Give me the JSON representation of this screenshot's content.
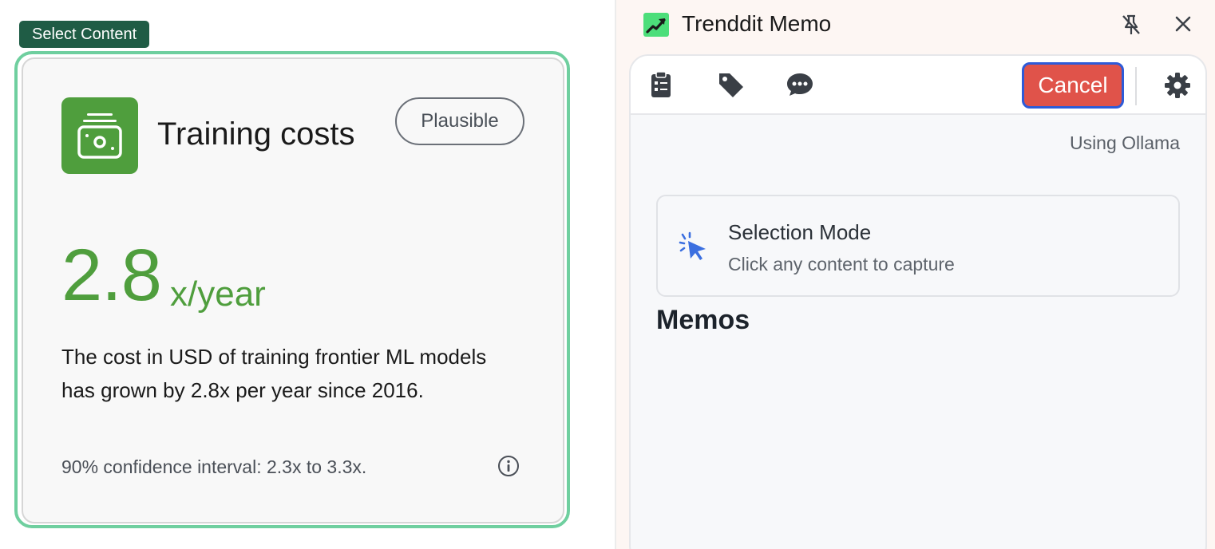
{
  "selection": {
    "tag_label": "Select Content"
  },
  "card": {
    "title": "Training costs",
    "badge": "Plausible",
    "value": "2.8",
    "unit": "x/year",
    "description": "The cost in USD of training frontier ML models has grown by 2.8x per year since 2016.",
    "confidence": "90% confidence interval: 2.3x to 3.3x.",
    "accent_color": "#4f9e3d",
    "icons": {
      "main": "money-icon",
      "info": "info-icon"
    }
  },
  "panel": {
    "title": "Trenddit Memo",
    "icons": {
      "logo": "trend-logo-icon",
      "unpin": "unpin-icon",
      "close": "close-icon"
    },
    "toolbar": {
      "tools": [
        "clipboard-icon",
        "tag-icon",
        "chat-icon"
      ],
      "cancel_label": "Cancel",
      "settings": "gear-icon"
    },
    "engine_note": "Using Ollama",
    "selection_mode": {
      "title": "Selection Mode",
      "subtitle": "Click any content to capture"
    },
    "memos_heading": "Memos"
  },
  "colors": {
    "select_frame": "#6fcf9f",
    "select_tag": "#1f5c45",
    "cancel_bg": "#e0534a",
    "cancel_border": "#2e5bd8",
    "cursor": "#3b6fe0"
  }
}
